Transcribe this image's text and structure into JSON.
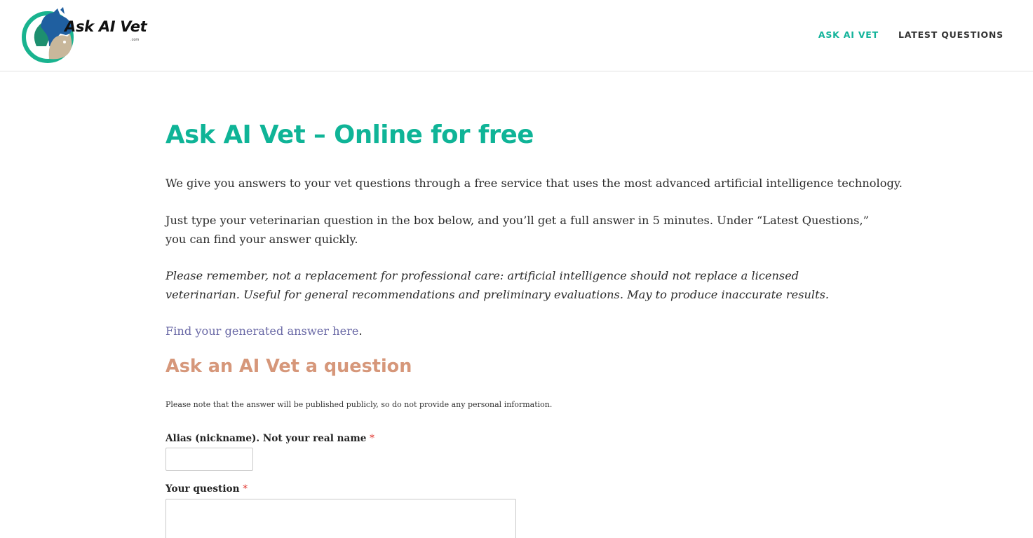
{
  "header": {
    "logo_text": "Ask AI Vet",
    "logo_subtext": ".com",
    "nav": [
      {
        "label": "ASK AI VET",
        "active": true
      },
      {
        "label": "LATEST QUESTIONS",
        "active": false
      }
    ]
  },
  "main": {
    "title": "Ask AI Vet – Online for free",
    "intro": "We give you answers to your vet questions through a free service that uses the most advanced artificial intelligence technology.",
    "instructions": "Just type your veterinarian question in the box below, and you’ll get a full answer in 5 minutes. Under “Latest Questions,” you can find your answer quickly.",
    "disclaimer": "Please remember, not a replacement for professional care: artificial intelligence should not replace a licensed veterinarian. Useful for general recommendations and preliminary evaluations. May to produce inaccurate results.",
    "answer_link_text": "Find your generated answer here",
    "answer_link_suffix": "."
  },
  "form": {
    "heading": "Ask an AI Vet a question",
    "notice": "Please note that the answer will be published publicly, so do not provide any personal information.",
    "alias_label": "Alias (nickname). Not your real name",
    "alias_value": "",
    "question_label": "Your question",
    "question_value": "",
    "required_mark": "*"
  },
  "colors": {
    "accent_teal": "#0fb497",
    "heading_peach": "#d6977a",
    "link_purple": "#6a69a6",
    "required_red": "#e0332c"
  }
}
